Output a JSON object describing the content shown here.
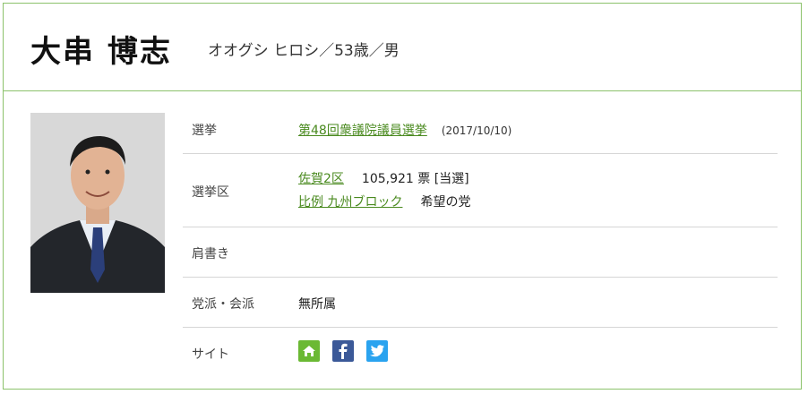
{
  "profile": {
    "name": "大串 博志",
    "kana_age_gender": "オオグシ ヒロシ／53歳／男"
  },
  "rows": {
    "election_label": "選挙",
    "election_name": "第48回衆議院議員選挙",
    "election_date": "(2017/10/10)",
    "district_label": "選挙区",
    "district_name": "佐賀2区",
    "district_result": "105,921 票 [当選]",
    "pr_block": "比例 九州ブロック",
    "party_hope": "希望の党",
    "title_label": "肩書き",
    "party_label": "党派・会派",
    "party_value": "無所属",
    "site_label": "サイト"
  },
  "site_icons": [
    "home-icon",
    "facebook-icon",
    "twitter-icon"
  ],
  "colors": {
    "accent": "#8cc26b",
    "link": "#4a8a1f",
    "home": "#6bb934",
    "facebook": "#3b5998",
    "twitter": "#2aa3ef"
  }
}
